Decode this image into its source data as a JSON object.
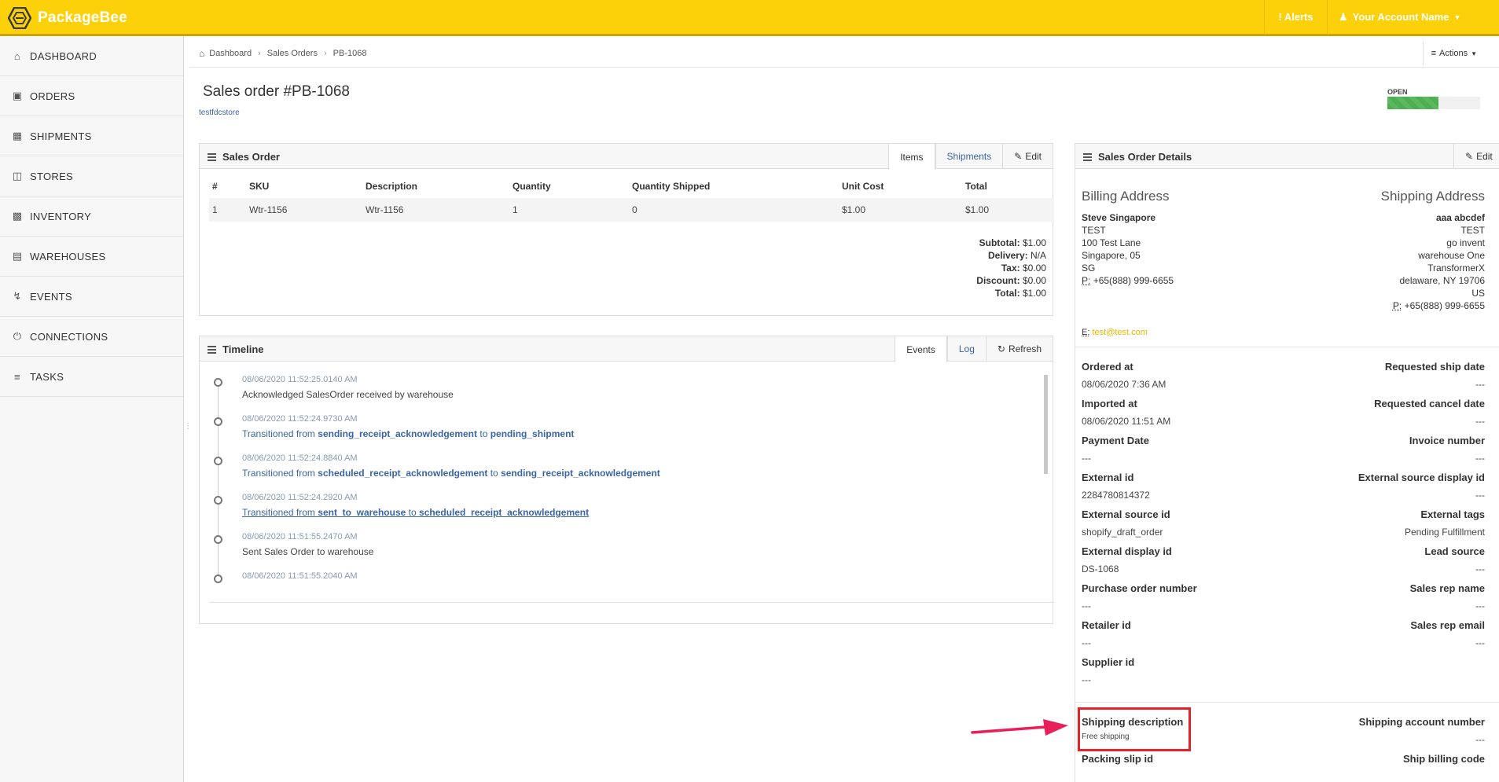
{
  "app": {
    "brand": "PackageBee",
    "alerts_label": "Alerts",
    "account_label": "Your Account Name",
    "brand_color": "#fdd10a"
  },
  "sidebar": {
    "items": [
      {
        "label": "DASHBOARD",
        "icon": "home-icon"
      },
      {
        "label": "ORDERS",
        "icon": "bag-icon"
      },
      {
        "label": "SHIPMENTS",
        "icon": "boxes-icon"
      },
      {
        "label": "STORES",
        "icon": "cart-icon"
      },
      {
        "label": "INVENTORY",
        "icon": "inventory-icon"
      },
      {
        "label": "WAREHOUSES",
        "icon": "warehouse-icon"
      },
      {
        "label": "EVENTS",
        "icon": "bolt-icon"
      },
      {
        "label": "CONNECTIONS",
        "icon": "plug-icon"
      },
      {
        "label": "TASKS",
        "icon": "list-icon"
      }
    ]
  },
  "breadcrumb": [
    "Dashboard",
    "Sales Orders",
    "PB-1068"
  ],
  "actions_label": "Actions",
  "page": {
    "title_prefix": "Sales order #",
    "order_number": "PB-1068",
    "store": "testfdcstore",
    "status": "OPEN",
    "status_progress": 0.55
  },
  "sales_order": {
    "title": "Sales Order",
    "tabs": [
      "Items",
      "Shipments"
    ],
    "edit_label": "Edit",
    "columns": [
      "#",
      "SKU",
      "Description",
      "Quantity",
      "Quantity Shipped",
      "Unit Cost",
      "Total"
    ],
    "rows": [
      [
        "1",
        "Wtr-1156",
        "Wtr-1156",
        "1",
        "0",
        "$1.00",
        "$1.00"
      ]
    ],
    "totals": [
      {
        "label": "Subtotal:",
        "value": "$1.00"
      },
      {
        "label": "Delivery:",
        "value": "N/A"
      },
      {
        "label": "Tax:",
        "value": "$0.00"
      },
      {
        "label": "Discount:",
        "value": "$0.00"
      },
      {
        "label": "Total:",
        "value": "$1.00"
      }
    ]
  },
  "timeline": {
    "title": "Timeline",
    "tabs": [
      "Events",
      "Log"
    ],
    "refresh_label": "Refresh",
    "events": [
      {
        "time": "08/06/2020 11:52:25.0140 AM",
        "msg": "Acknowledged SalesOrder received by warehouse"
      },
      {
        "time": "08/06/2020 11:52:24.9730 AM",
        "prefix": "Transitioned from",
        "from": "sending_receipt_acknowledgement",
        "mid": "to",
        "to": "pending_shipment"
      },
      {
        "time": "08/06/2020 11:52:24.8840 AM",
        "prefix": "Transitioned from",
        "from": "scheduled_receipt_acknowledgement",
        "mid": "to",
        "to": "sending_receipt_acknowledgement"
      },
      {
        "time": "08/06/2020 11:52:24.2920 AM",
        "prefix": "Transitioned from",
        "from": "sent_to_warehouse",
        "mid": "to",
        "to": "scheduled_receipt_acknowledgement"
      },
      {
        "time": "08/06/2020 11:51:55.2470 AM",
        "msg": "Sent Sales Order to warehouse"
      },
      {
        "time": "08/06/2020 11:51:55.2040 AM",
        "msg": ""
      }
    ]
  },
  "details": {
    "title": "Sales Order Details",
    "edit_label": "Edit",
    "billing": {
      "heading": "Billing Address",
      "name": "Steve Singapore",
      "lines": [
        "TEST",
        "100 Test Lane",
        "Singapore, 05",
        "SG"
      ],
      "phone_label": "P:",
      "phone": "+65(888) 999-6655",
      "email_label": "E:",
      "email": "test@test.com"
    },
    "shipping": {
      "heading": "Shipping Address",
      "name": "aaa abcdef",
      "lines": [
        "TEST",
        "go invent",
        "warehouse One",
        "TransformerX",
        "delaware, NY 19706",
        "US"
      ],
      "phone_label": "P:",
      "phone": "+65(888) 999-6655"
    },
    "fields_left": [
      {
        "k": "Ordered at",
        "v": "08/06/2020 7:36 AM"
      },
      {
        "k": "Imported at",
        "v": "08/06/2020 11:51 AM"
      },
      {
        "k": "Payment Date",
        "v": "---"
      },
      {
        "k": "External id",
        "v": "2284780814372"
      },
      {
        "k": "External source id",
        "v": "shopify_draft_order"
      },
      {
        "k": "External display id",
        "v": "DS-1068"
      },
      {
        "k": "Purchase order number",
        "v": "---"
      },
      {
        "k": "Retailer id",
        "v": "---"
      },
      {
        "k": "Supplier id",
        "v": "---"
      }
    ],
    "fields_right": [
      {
        "k": "Requested ship date",
        "v": "---"
      },
      {
        "k": "Requested cancel date",
        "v": "---"
      },
      {
        "k": "Invoice number",
        "v": "---"
      },
      {
        "k": "External source display id",
        "v": "---"
      },
      {
        "k": "External tags",
        "v": "Pending Fulfillment"
      },
      {
        "k": "Lead source",
        "v": "---"
      },
      {
        "k": "Sales rep name",
        "v": "---"
      },
      {
        "k": "Sales rep email",
        "v": "---"
      }
    ],
    "shipping_description": {
      "k": "Shipping description",
      "v": "Free shipping"
    },
    "shipping_account": {
      "k": "Shipping account number",
      "v": "---"
    },
    "packing_slip": {
      "k": "Packing slip id"
    },
    "ship_billing_code": {
      "k": "Ship billing code"
    }
  }
}
